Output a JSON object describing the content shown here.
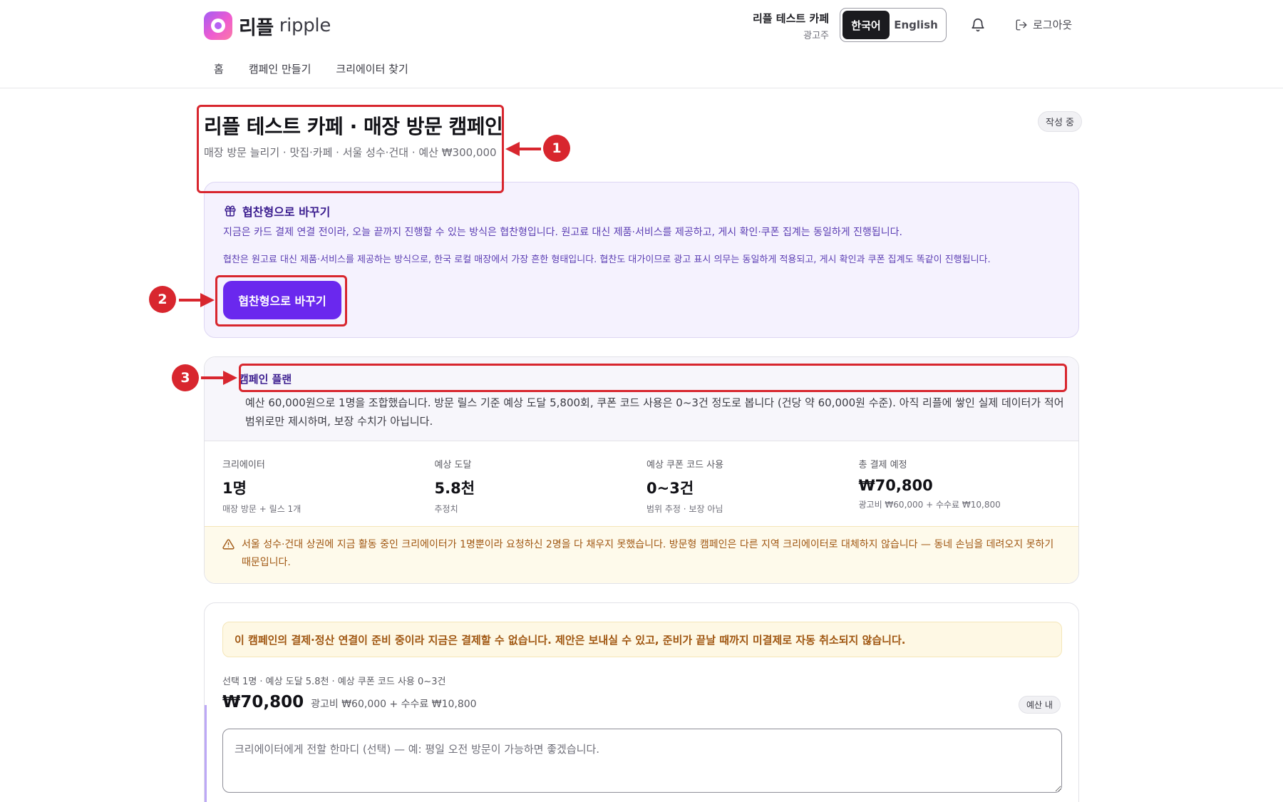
{
  "header": {
    "logo_ko": "리플",
    "logo_en": "ripple",
    "account_name": "리플 테스트 카페",
    "account_role": "광고주",
    "lang_active": "한국어",
    "lang_inactive": "English",
    "logout": "로그아웃"
  },
  "nav": [
    "홈",
    "캠페인 만들기",
    "크리에이터 찾기"
  ],
  "campaign": {
    "title": "리플 테스트 카페 · 매장 방문 캠페인",
    "subtitle": "매장 방문 늘리기 · 맛집·카페 · 서울 성수·건대 · 예산 ₩300,000",
    "status": "작성 중"
  },
  "barter": {
    "heading": "협찬형으로 바꾸기",
    "line1": "지금은 카드 결제 연결 전이라, 오늘 끝까지 진행할 수 있는 방식은 협찬형입니다. 원고료 대신 제품·서비스를 제공하고, 게시 확인·쿠폰 집계는 동일하게 진행됩니다.",
    "line2": "협찬은 원고료 대신 제품·서비스를 제공하는 방식으로, 한국 로컬 매장에서 가장 흔한 형태입니다. 협찬도 대가이므로 광고 표시 의무는 동일하게 적용되고, 게시 확인과 쿠폰 집계도 똑같이 진행됩니다.",
    "button": "협찬형으로 바꾸기"
  },
  "plan": {
    "heading": "캠페인 플랜",
    "description": "예산 60,000원으로 1명을 조합했습니다. 방문 릴스 기준 예상 도달 5,800회, 쿠폰 코드 사용은 0~3건 정도로 봅니다 (건당 약 60,000원 수준). 아직 리플에 쌓인 실제 데이터가 적어 범위로만 제시하며, 보장 수치가 아닙니다.",
    "stats": [
      {
        "label": "크리에이터",
        "value": "1명",
        "note": "매장 방문 + 릴스 1개"
      },
      {
        "label": "예상 도달",
        "value": "5.8천",
        "note": "추정치"
      },
      {
        "label": "예상 쿠폰 코드 사용",
        "value": "0~3건",
        "note": "범위 추정 · 보장 아님"
      },
      {
        "label": "총 결제 예정",
        "value": "₩70,800",
        "note": "광고비 ₩60,000 + 수수료 ₩10,800"
      }
    ],
    "warning": "서울 성수·건대 상권에 지금 활동 중인 크리에이터가 1명뿐이라 요청하신 2명을 다 채우지 못했습니다. 방문형 캠페인은 다른 지역 크리에이터로 대체하지 않습니다 — 동네 손님을 데려오지 못하기 때문입니다."
  },
  "checkout": {
    "notice": "이 캠페인의 결제·정산 연결이 준비 중이라 지금은 결제할 수 없습니다. 제안은 보내실 수 있고, 준비가 끝날 때까지 미결제로 자동 취소되지 않습니다.",
    "summary": "선택 1명 · 예상 도달 5.8천 · 예상 쿠폰 코드 사용 0~3건",
    "price": "₩70,800",
    "breakdown": "광고비 ₩60,000 + 수수료 ₩10,800",
    "budget_badge": "예산 내",
    "message_placeholder": "크리에이터에게 전할 한마디 (선택) — 예: 평일 오전 방문이 가능하면 좋겠습니다."
  },
  "annotations": {
    "marker_1": "1",
    "marker_2": "2",
    "marker_3": "3",
    "color": "#d8262e"
  },
  "colors": {
    "accent": "#6a28ee",
    "accent_text": "#3b1d8f",
    "warning_text": "#a05712"
  }
}
